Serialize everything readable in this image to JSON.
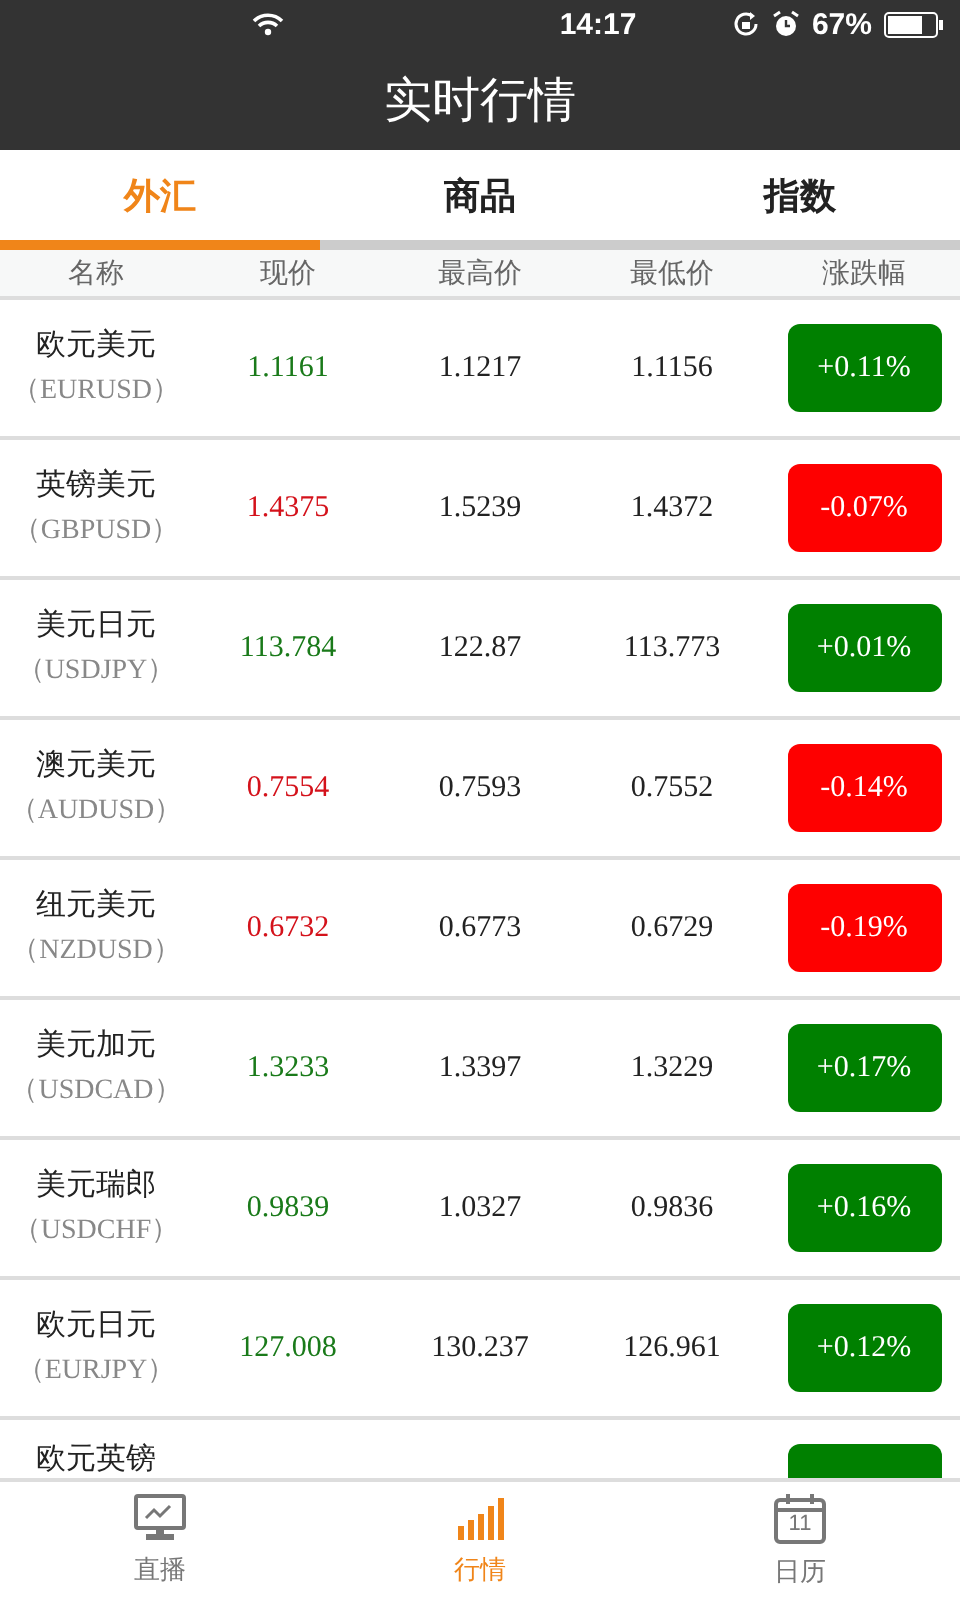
{
  "status_bar": {
    "time": "14:17",
    "battery": "67%"
  },
  "title": "实时行情",
  "tabs": [
    {
      "label": "外汇",
      "selected": true
    },
    {
      "label": "商品",
      "selected": false
    },
    {
      "label": "指数",
      "selected": false
    }
  ],
  "columns": [
    "名称",
    "现价",
    "最高价",
    "最低价",
    "涨跌幅"
  ],
  "rows": [
    {
      "name": "欧元美元",
      "code": "（EURUSD）",
      "price": "1.1161",
      "high": "1.1217",
      "low": "1.1156",
      "change": "+0.11%",
      "rising": true
    },
    {
      "name": "英镑美元",
      "code": "（GBPUSD）",
      "price": "1.4375",
      "high": "1.5239",
      "low": "1.4372",
      "change": "-0.07%",
      "rising": false
    },
    {
      "name": "美元日元",
      "code": "（USDJPY）",
      "price": "113.784",
      "high": "122.87",
      "low": "113.773",
      "change": "+0.01%",
      "rising": true
    },
    {
      "name": "澳元美元",
      "code": "（AUDUSD）",
      "price": "0.7554",
      "high": "0.7593",
      "low": "0.7552",
      "change": "-0.14%",
      "rising": false
    },
    {
      "name": "纽元美元",
      "code": "（NZDUSD）",
      "price": "0.6732",
      "high": "0.6773",
      "low": "0.6729",
      "change": "-0.19%",
      "rising": false
    },
    {
      "name": "美元加元",
      "code": "（USDCAD）",
      "price": "1.3233",
      "high": "1.3397",
      "low": "1.3229",
      "change": "+0.17%",
      "rising": true
    },
    {
      "name": "美元瑞郎",
      "code": "（USDCHF）",
      "price": "0.9839",
      "high": "1.0327",
      "low": "0.9836",
      "change": "+0.16%",
      "rising": true
    },
    {
      "name": "欧元日元",
      "code": "（EURJPY）",
      "price": "127.008",
      "high": "130.237",
      "low": "126.961",
      "change": "+0.12%",
      "rising": true
    },
    {
      "name": "欧元英镑",
      "rising": true
    }
  ],
  "nav": [
    {
      "label": "直播",
      "selected": false
    },
    {
      "label": "行情",
      "selected": true
    },
    {
      "label": "日历",
      "icon_text": "11",
      "selected": false
    }
  ]
}
